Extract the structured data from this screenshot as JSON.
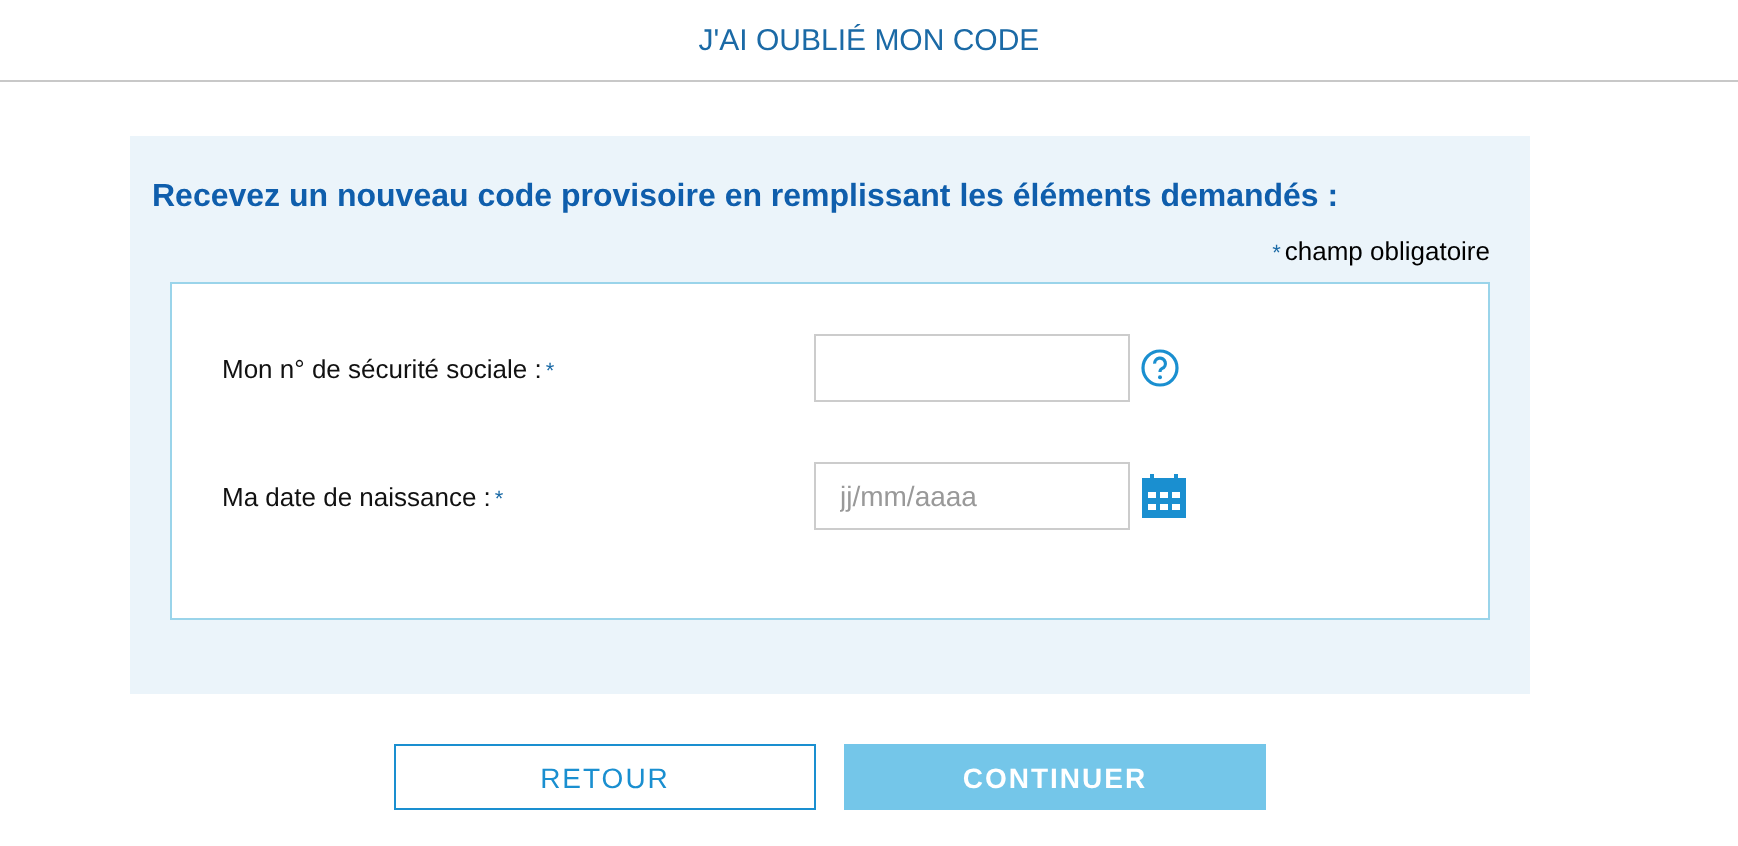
{
  "header": {
    "title": "J'AI OUBLIÉ MON CODE"
  },
  "panel": {
    "heading": "Recevez un nouveau code provisoire en remplissant les éléments demandés :",
    "legend": {
      "marker": "*",
      "text": "champ obligatoire"
    },
    "fields": [
      {
        "kind": "text",
        "label": "Mon n° de sécurité sociale :",
        "marker": "*"
      },
      {
        "kind": "date",
        "label": "Ma date de naissance :",
        "marker": "*",
        "placeholder": "jj/mm/aaaa"
      }
    ]
  },
  "buttons": [
    {
      "kind": "secondary",
      "label": "RETOUR",
      "disabled": false
    },
    {
      "kind": "primary",
      "label": "CONTINUER",
      "disabled": true
    }
  ]
}
